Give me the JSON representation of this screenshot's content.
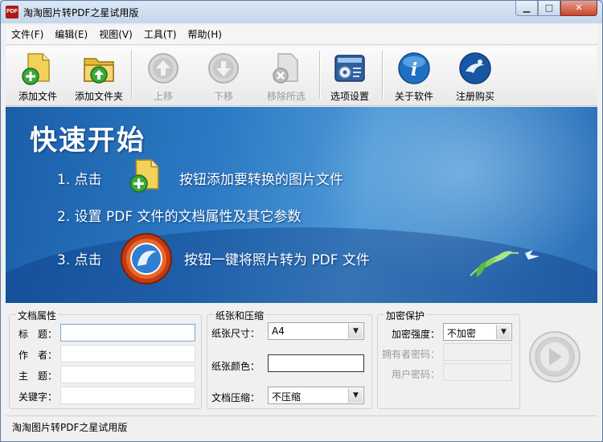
{
  "window": {
    "title": "淘淘图片转PDF之星试用版",
    "icon_text": "PDF"
  },
  "window_controls": {
    "minimize": "▁",
    "maximize": "□",
    "close": "✕"
  },
  "menu": [
    {
      "label": "文件(F)"
    },
    {
      "label": "编辑(E)"
    },
    {
      "label": "视图(V)"
    },
    {
      "label": "工具(T)"
    },
    {
      "label": "帮助(H)"
    }
  ],
  "toolbar": [
    {
      "label": "添加文件",
      "icon": "add-file-icon",
      "enabled": true
    },
    {
      "label": "添加文件夹",
      "icon": "add-folder-icon",
      "enabled": true
    },
    {
      "label": "上移",
      "icon": "move-up-icon",
      "enabled": false
    },
    {
      "label": "下移",
      "icon": "move-down-icon",
      "enabled": false
    },
    {
      "label": "移除所选",
      "icon": "remove-selected-icon",
      "enabled": false
    },
    {
      "label": "选项设置",
      "icon": "options-icon",
      "enabled": true
    },
    {
      "label": "关于软件",
      "icon": "about-icon",
      "enabled": true
    },
    {
      "label": "注册购买",
      "icon": "register-icon",
      "enabled": true
    }
  ],
  "banner": {
    "title": "快速开始",
    "step1_pre": "1. 点击",
    "step1_post": "按钮添加要转换的图片文件",
    "step2": "2. 设置 PDF 文件的文档属性及其它参数",
    "step3_pre": "3. 点击",
    "step3_post": "按钮一键将照片转为 PDF 文件"
  },
  "doc_props": {
    "group_title": "文档属性",
    "title_label": "标　题：",
    "author_label": "作　者：",
    "subject_label": "主　题：",
    "keywords_label": "关键字：",
    "title_value": "",
    "author_value": "",
    "subject_value": "",
    "keywords_value": ""
  },
  "paper": {
    "group_title": "纸张和压缩",
    "size_label": "纸张尺寸：",
    "size_value": "A4",
    "color_label": "纸张颜色：",
    "color_value": "#ffffff",
    "compress_label": "文档压缩：",
    "compress_value": "不压缩"
  },
  "encrypt": {
    "group_title": "加密保护",
    "strength_label": "加密强度：",
    "strength_value": "不加密",
    "owner_pwd_label": "拥有者密码：",
    "user_pwd_label": "用户密码：",
    "owner_pwd_value": "",
    "user_pwd_value": ""
  },
  "status": {
    "text": "淘淘图片转PDF之星试用版"
  },
  "colors": {
    "banner_blue": "#2c7ac4",
    "disabled_text": "#9a9a9a"
  }
}
